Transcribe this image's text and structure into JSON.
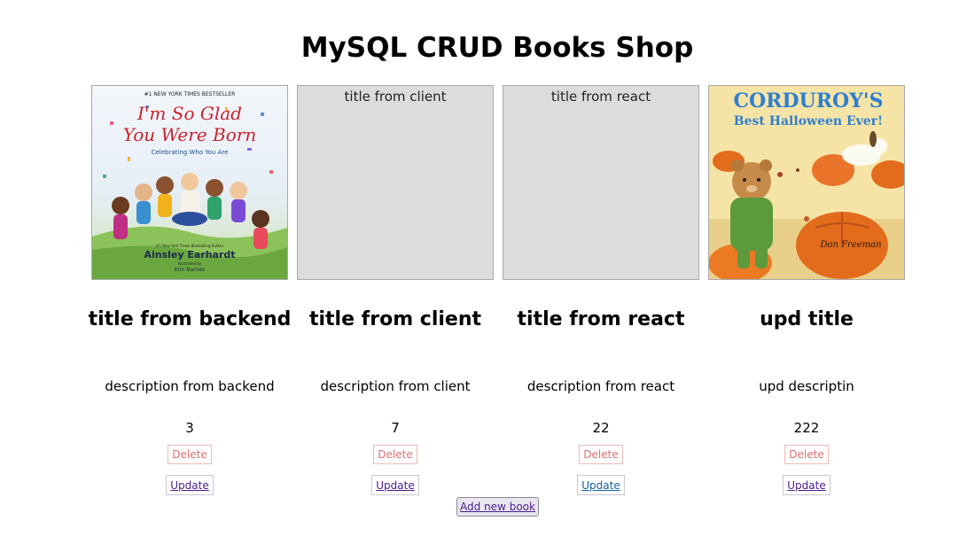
{
  "page": {
    "title": "MySQL CRUD Books Shop"
  },
  "books": [
    {
      "cover_alt": "",
      "has_cover_image": true,
      "cover": {
        "top_line": "#1 NEW YORK TIMES BESTSELLER",
        "title_line1": "I'm So Glad",
        "title_line2": "You Were Born",
        "subtitle": "Celebrating Who You Are",
        "author_note": "#1 New York Times Bestselling Author",
        "author": "Ainsley Earhardt",
        "illustrator_note": "Illustrated by",
        "illustrator": "Kim Barnes"
      },
      "title": "title from backend",
      "description": "description from backend",
      "price": "3",
      "delete_label": "Delete",
      "update_label": "Update"
    },
    {
      "cover_alt": "title from client",
      "has_cover_image": false,
      "title": "title from client",
      "description": "description from client",
      "price": "7",
      "delete_label": "Delete",
      "update_label": "Update"
    },
    {
      "cover_alt": "title from react",
      "has_cover_image": false,
      "title": "title from react",
      "description": "description from react",
      "price": "22",
      "delete_label": "Delete",
      "update_label": "Update"
    },
    {
      "cover_alt": "",
      "has_cover_image": true,
      "cover": {
        "title_line1": "CORDUROY'S",
        "title_line2": "Best Halloween Ever!",
        "author": "Don Freeman"
      },
      "title": "upd title",
      "description": "upd descriptin",
      "price": "222",
      "delete_label": "Delete",
      "update_label": "Update"
    }
  ],
  "actions": {
    "add_label": "Add new book"
  },
  "colors": {
    "placeholder_bg": "#dcdcdc",
    "delete_text": "#e07070",
    "link_visited": "#4b1c8f",
    "link_unvisited": "#1a5fa8"
  }
}
